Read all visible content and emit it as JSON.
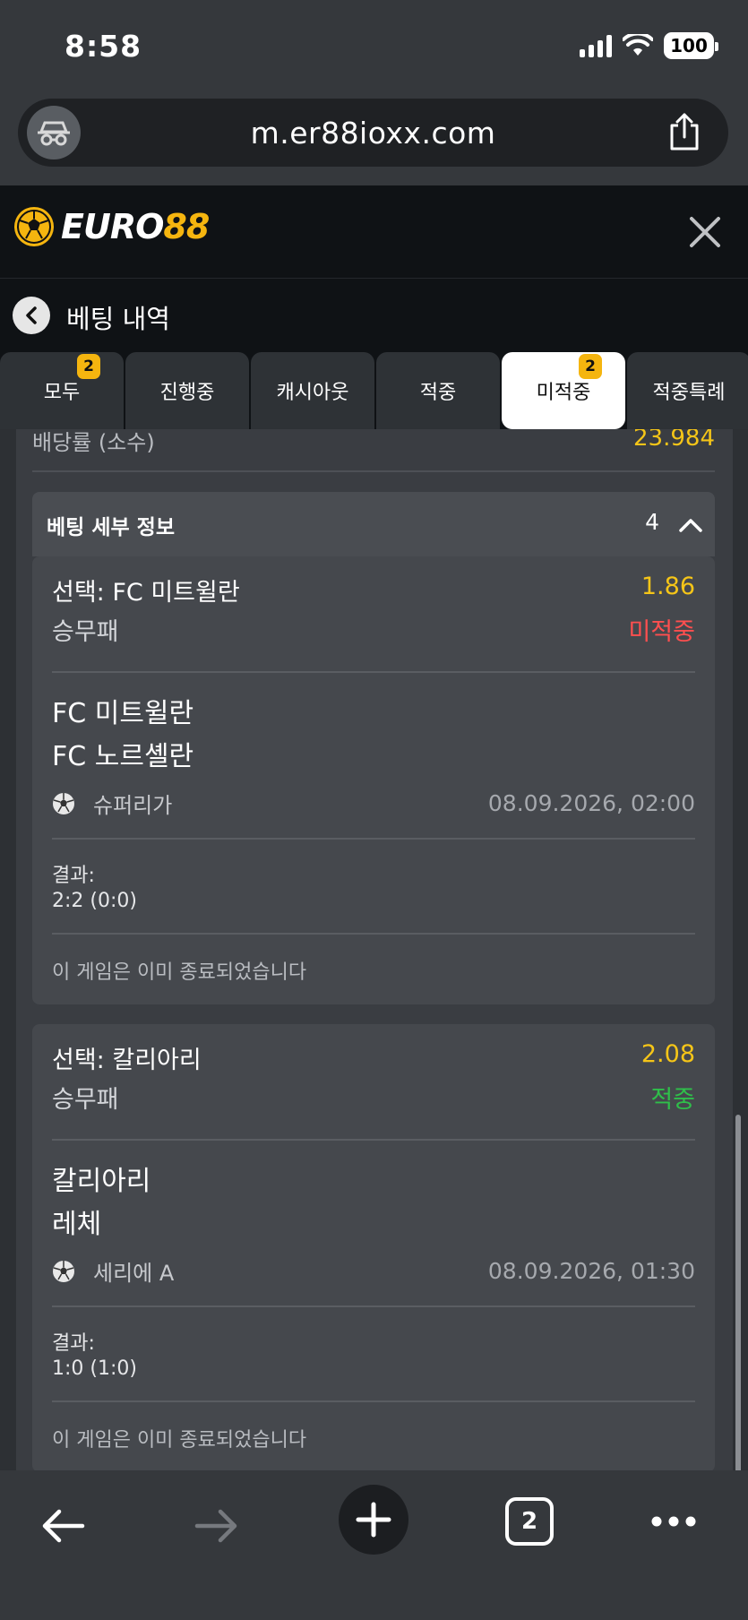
{
  "status_bar": {
    "time": "8:58",
    "battery": "100"
  },
  "browser": {
    "url": "m.er88ioxx.com",
    "tab_count": "2"
  },
  "site": {
    "logo_part1": "EURO",
    "logo_part2": "88"
  },
  "page": {
    "title": "베팅 내역"
  },
  "tabs": [
    {
      "label": "모두",
      "badge": "2"
    },
    {
      "label": "진행중",
      "badge": ""
    },
    {
      "label": "캐시아웃",
      "badge": ""
    },
    {
      "label": "적중",
      "badge": ""
    },
    {
      "label": "미적중",
      "badge": "2"
    },
    {
      "label": "적중특례",
      "badge": ""
    }
  ],
  "summary": {
    "label": "배당률 (소수)",
    "value": "23.984"
  },
  "details": {
    "title": "베팅 세부 정보",
    "count": "4"
  },
  "bets": [
    {
      "selection": "선택: FC 미트윌란",
      "odds": "1.86",
      "market": "승무패",
      "status": "미적중",
      "team_home": "FC 미트윌란",
      "team_away": "FC 노르셸란",
      "league": "슈퍼리가",
      "datetime": "08.09.2026, 02:00",
      "result_label": "결과:",
      "result_value": "2:2 (0:0)",
      "note": "이 게임은 이미 종료되었습니다"
    },
    {
      "selection": "선택: 칼리아리",
      "odds": "2.08",
      "market": "승무패",
      "status": "적중",
      "team_home": "칼리아리",
      "team_away": "레체",
      "league": "세리에 A",
      "datetime": "08.09.2026, 01:30",
      "result_label": "결과:",
      "result_value": "1:0 (1:0)",
      "note": "이 게임은 이미 종료되었습니다"
    }
  ],
  "colors": {
    "accent": "#f5b50f",
    "lose": "#ff4f4f",
    "win": "#2fbf4a"
  }
}
